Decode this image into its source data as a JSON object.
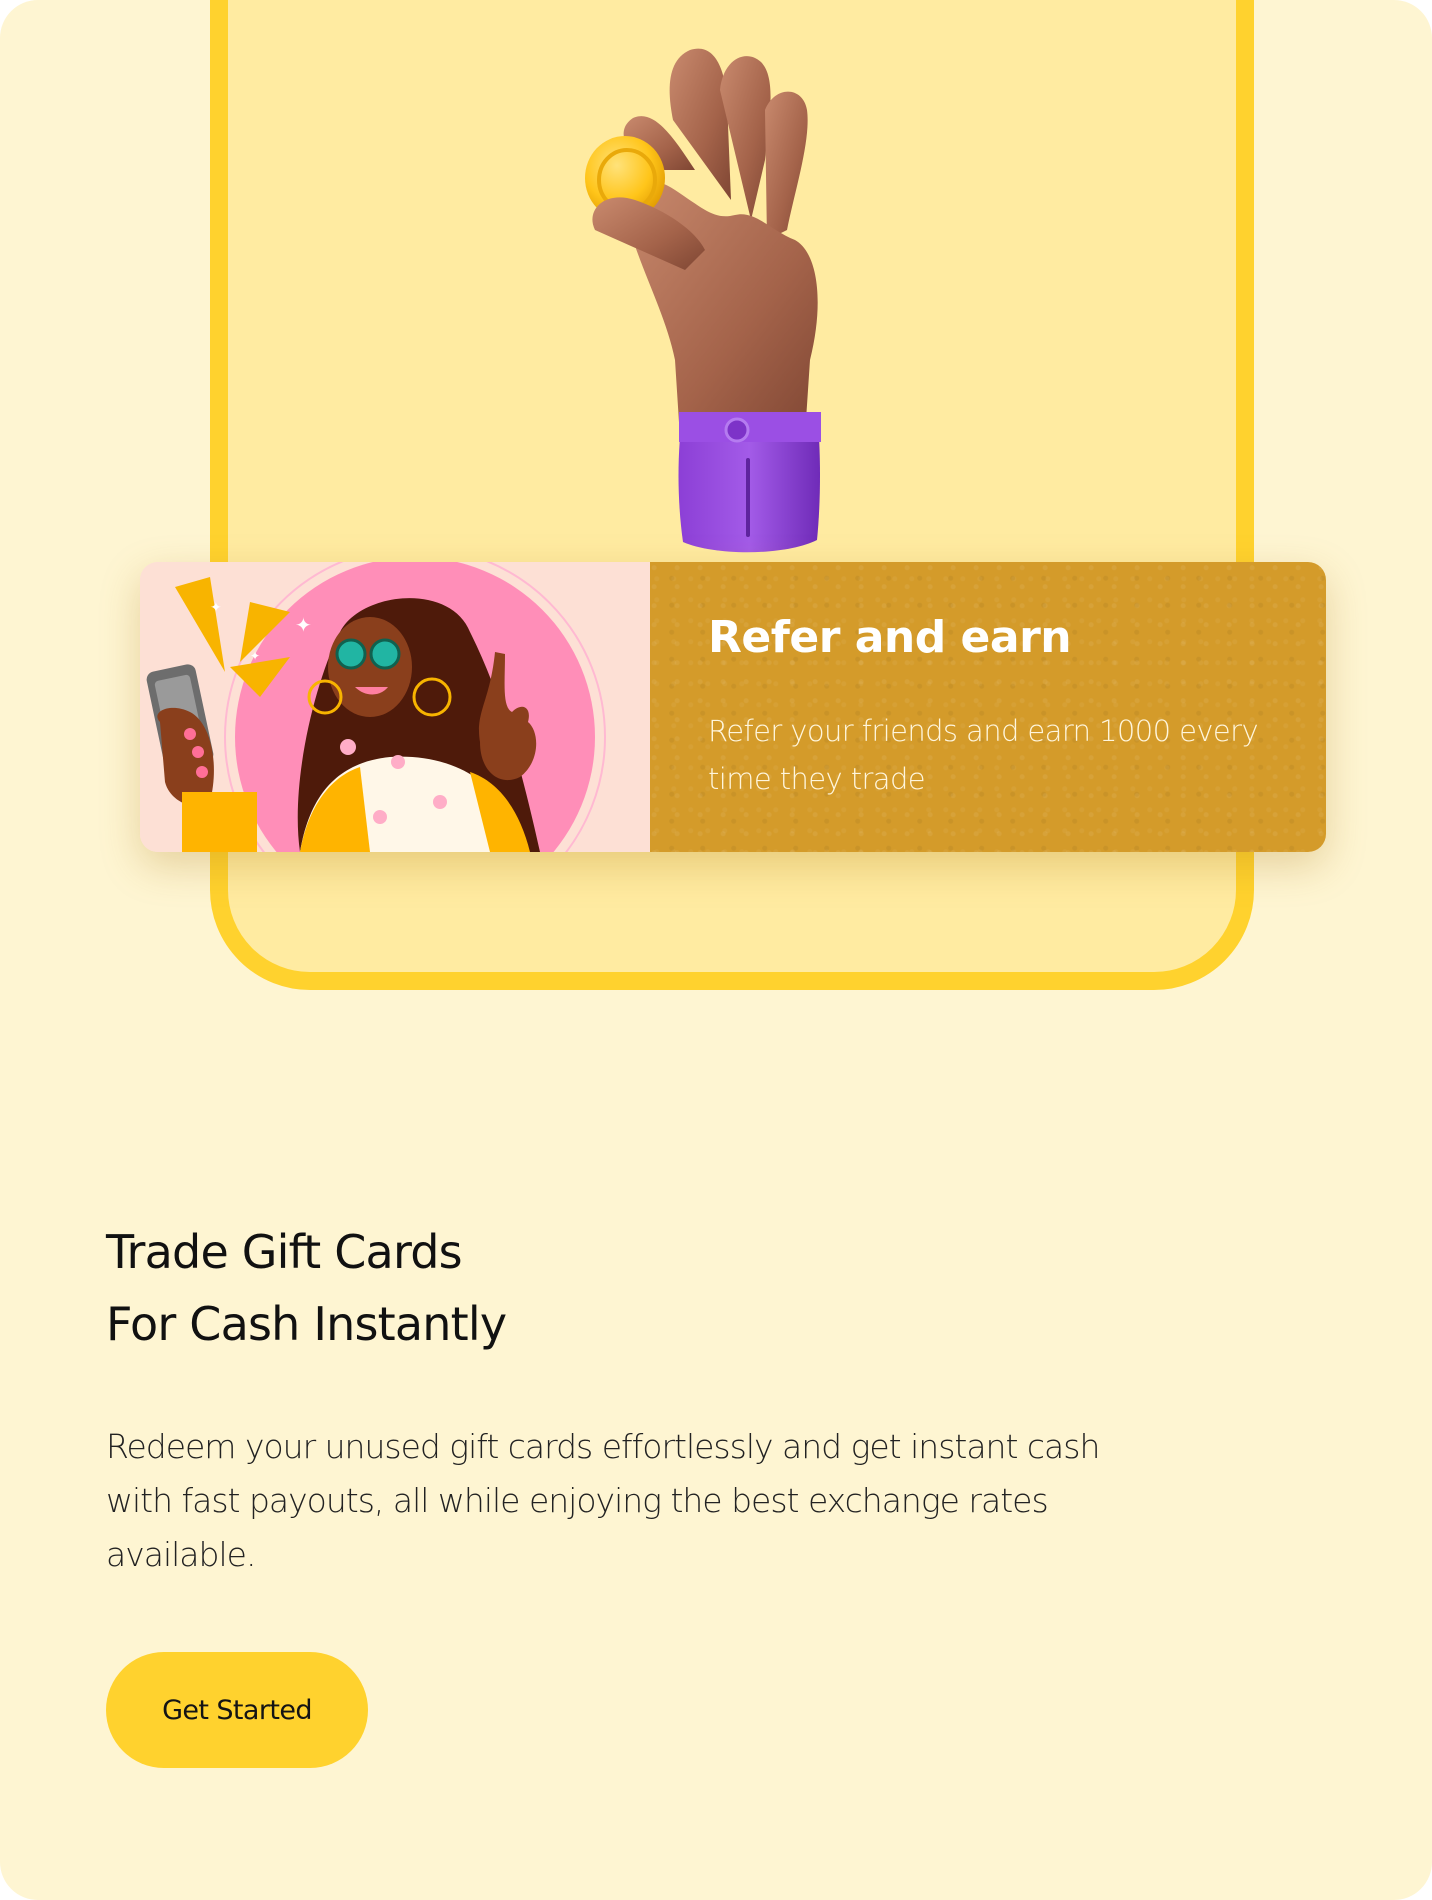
{
  "refer": {
    "title": "Refer and earn",
    "description": "Refer your friends and earn 1000 every time they trade"
  },
  "hero": {
    "title_line1": "Trade Gift Cards",
    "title_line2": "For Cash Instantly",
    "description": "Redeem your unused gift cards effortlessly and get instant cash with fast payouts, all while enjoying the best exchange rates available.",
    "cta_label": "Get Started"
  },
  "colors": {
    "page_background": "#FEF5D2",
    "frame_fill": "#FFEBA1",
    "frame_border": "#FFD22E",
    "refer_panel": "#D49B2A",
    "cta_background": "#FFD22E",
    "text_dark": "#111111"
  },
  "images": {
    "hand": "hand-holding-coin-illustration",
    "refer": "woman-with-phone-peace-sign-illustration"
  }
}
